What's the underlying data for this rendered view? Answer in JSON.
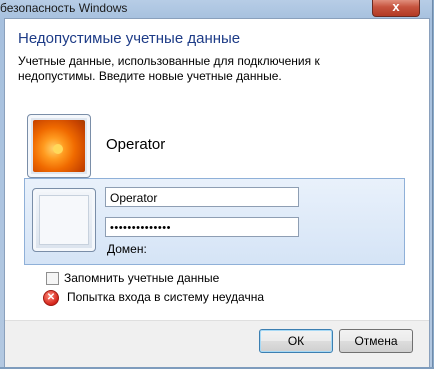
{
  "window": {
    "title": "безопасность Windows",
    "close_glyph": "x"
  },
  "dialog": {
    "heading": "Недопустимые учетные данные",
    "description_part1": "Учетные данные, использованные для подключения к",
    "description_part2": "недопустимы. Введите новые учетные данные."
  },
  "accounts": [
    {
      "name": "Operator",
      "icon": "flower-user-icon"
    }
  ],
  "login": {
    "username_value": "Operator",
    "password_masked": "••••••••••••••",
    "domain_label": "Домен:"
  },
  "remember": {
    "label": "Запомнить учетные данные",
    "checked": false
  },
  "error": {
    "text": "Попытка входа в систему неудачна",
    "icon": "error-icon"
  },
  "buttons": {
    "ok": "ОК",
    "cancel": "Отмена"
  },
  "colors": {
    "heading": "#1e3c87",
    "selected_tile": "#d5e4f6",
    "close": "#c6533e"
  }
}
